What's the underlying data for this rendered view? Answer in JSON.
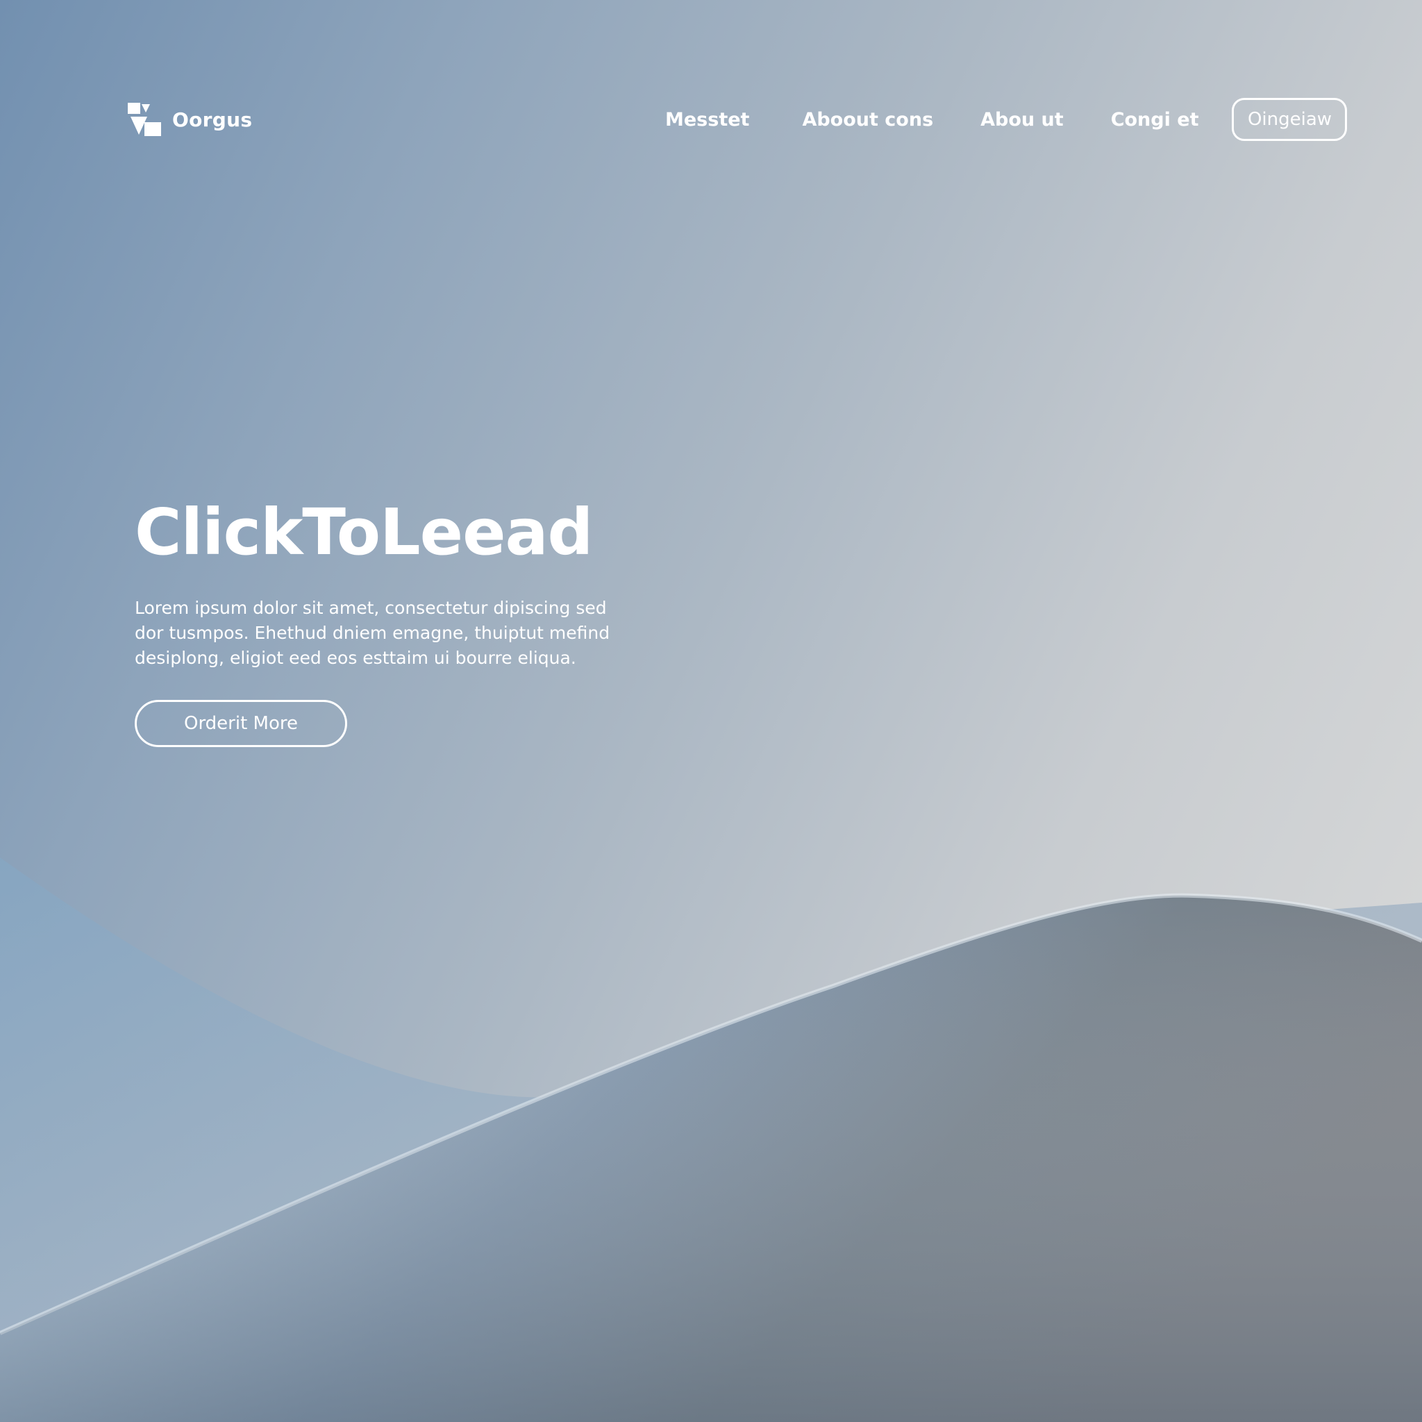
{
  "brand": {
    "name": "Oorgus",
    "logo_icon": "geometric-shapes-logo-icon"
  },
  "nav": {
    "links": [
      {
        "label": "Messtet"
      },
      {
        "label": "Aboout cons"
      },
      {
        "label": "Abou ut"
      },
      {
        "label": "Congi et"
      }
    ],
    "cta_label": "Oingeiaw"
  },
  "hero": {
    "title": "ClickToLeead",
    "body": "Lorem ipsum dolor sit amet, consectetur dipiscing sed dor tusmpos. Ehethud dniem emagne, thuiptut mefind desiplong, eligiot eed eos esttaim ui bourre eliqua.",
    "button_label": "Orderit More"
  },
  "colors": {
    "background_start": "#7290b0",
    "background_end": "#dcdcdb",
    "text": "#ffffff",
    "wave_grey": "#7b858f"
  }
}
